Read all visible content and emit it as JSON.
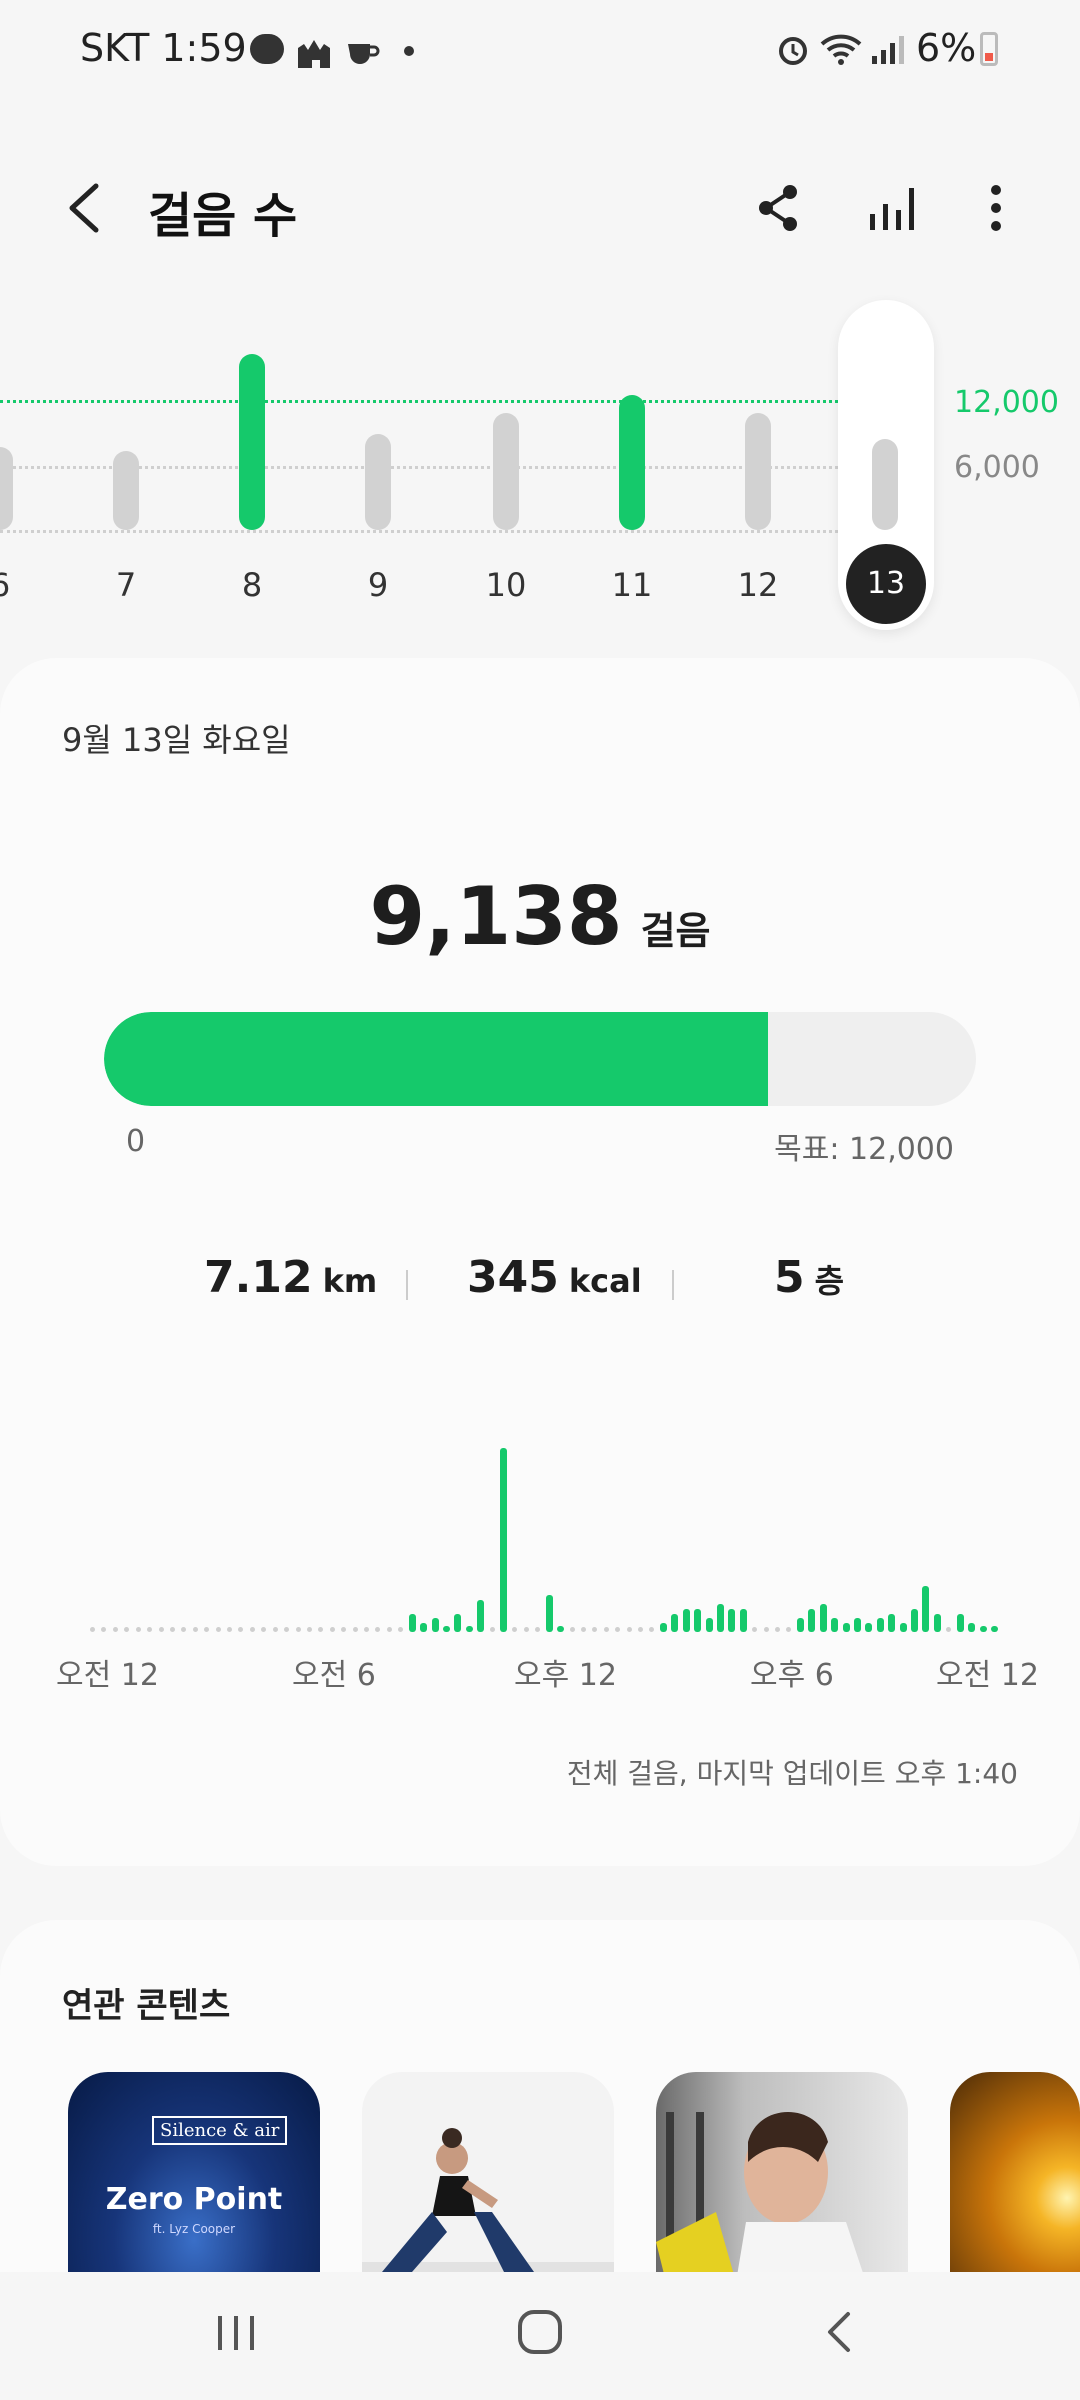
{
  "status": {
    "time": "SKT 1:59",
    "battery": "6%"
  },
  "header": {
    "title": "걸음 수"
  },
  "week": {
    "days": [
      "6",
      "7",
      "8",
      "9",
      "10",
      "11",
      "12",
      "13"
    ],
    "steps": [
      5500,
      5200,
      11600,
      6300,
      7700,
      8900,
      7700,
      6000
    ],
    "goal": 12000,
    "y_ticks": [
      "12,000",
      "6,000"
    ],
    "selected_day": "13"
  },
  "summary": {
    "date": "9월 13일 화요일",
    "steps": "9,138",
    "steps_unit": "걸음",
    "progress_fraction": 0.762,
    "progress_start": "0",
    "goal_label": "목표: 12,000",
    "distance_value": "7.12",
    "distance_unit": "km",
    "kcal_value": "345",
    "kcal_unit": "kcal",
    "floors_value": "5",
    "floors_unit": "층"
  },
  "hourly": {
    "x_labels": [
      "오전 12",
      "오전 6",
      "오후 12",
      "오후 6",
      "오전 12"
    ],
    "values": [
      0,
      0,
      0,
      0,
      0,
      0,
      0,
      0,
      0,
      0,
      0,
      0,
      0,
      0,
      0,
      0,
      0,
      0,
      0,
      0,
      0,
      0,
      0,
      0,
      0,
      0,
      0,
      0,
      4,
      2,
      3,
      1,
      4,
      1,
      7,
      0,
      40,
      0,
      0,
      0,
      8,
      1,
      0,
      0,
      0,
      0,
      0,
      0,
      0,
      0,
      2,
      4,
      5,
      5,
      3,
      6,
      5,
      5,
      0,
      0,
      0,
      0,
      3,
      5,
      6,
      3,
      2,
      3,
      2,
      3,
      4,
      2,
      5,
      10,
      4,
      0,
      4,
      2,
      1,
      1
    ]
  },
  "updated": "전체 걸음, 마지막 업데이트 오후 1:40",
  "related": {
    "title": "연관 콘텐츠",
    "card1_brand": "Silence & air",
    "card1_title": "Zero Point",
    "card1_sub": "ft. Lyz Cooper"
  },
  "colors": {
    "accent": "#15c96b",
    "inactive": "#d2d2d2"
  }
}
